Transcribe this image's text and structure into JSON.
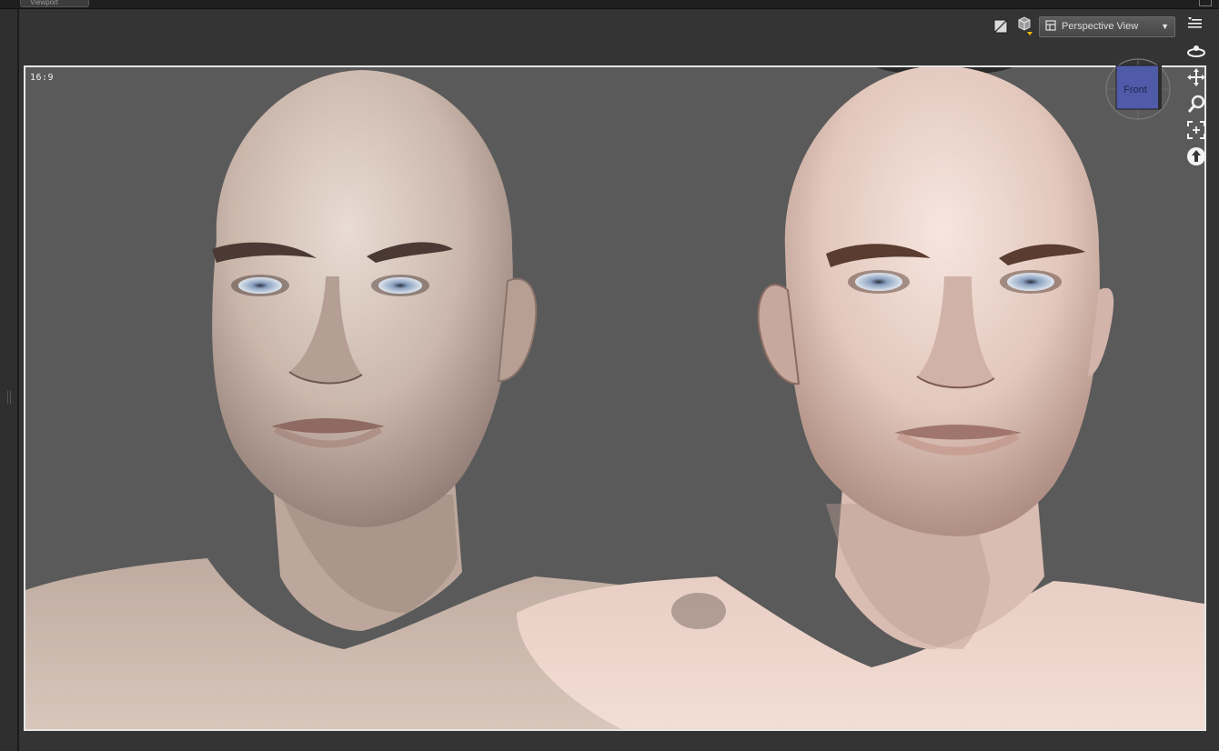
{
  "window": {
    "tab_label": "Viewport"
  },
  "toolbar": {
    "render_preview_icon": "render-settings-icon",
    "draw_style_icon": "draw-style-icon",
    "camera_dropdown": {
      "icon": "camera-icon",
      "selected": "Perspective View"
    },
    "menu_icon": "viewport-menu-icon"
  },
  "viewport": {
    "aspect_label": "16:9",
    "view_cube_face": "Front",
    "nav_controls": [
      {
        "name": "orbit-icon"
      },
      {
        "name": "translate-icon"
      },
      {
        "name": "zoom-icon"
      },
      {
        "name": "frame-icon"
      },
      {
        "name": "reset-view-icon"
      }
    ]
  },
  "colors": {
    "viewport_bg": "#5a5a5a",
    "panel_bg": "#343434",
    "border": "#e6e6e6",
    "accent": "#f0c000",
    "cube_face": "#4f5aa8"
  }
}
